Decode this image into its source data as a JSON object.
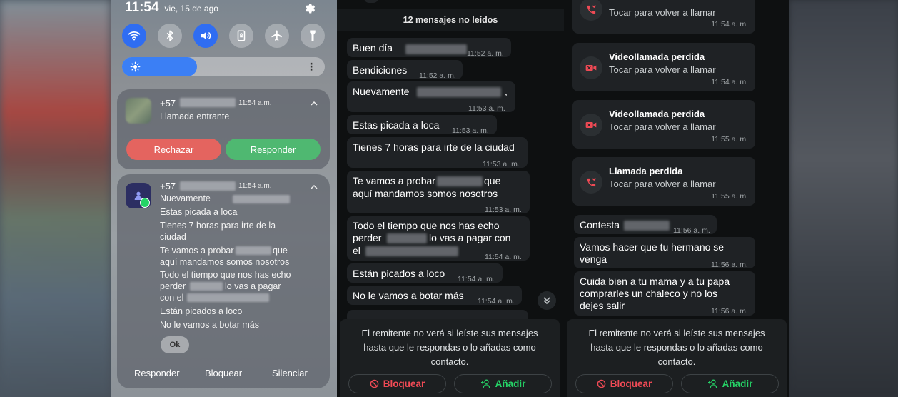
{
  "shade": {
    "time": "11:54",
    "date": "vie, 15 de ago",
    "brightness": 0.37,
    "call_notification": {
      "number": "+57",
      "time": "11:54 a.m.",
      "title": "Llamada entrante",
      "reject_label": "Rechazar",
      "answer_label": "Responder",
      "reject_color": "#e4645f",
      "answer_color": "#4fb871"
    },
    "wa_notification": {
      "number": "+57",
      "time": "11:54 a.m.",
      "lines": [
        "Nuevamente",
        "Estas picada a loca",
        "Tienes 7 horas para irte de la",
        "ciudad",
        "Te vamos a probar",
        "que",
        "aquí mandamos somos nosotros",
        "Todo el tiempo que nos has echo",
        "perder",
        "lo vas a pagar",
        "con el",
        "Están picados a loco",
        "No le vamos a botar más"
      ],
      "ok_label": "Ok",
      "actions": [
        "Responder",
        "Bloquear",
        "Silenciar"
      ]
    }
  },
  "chat_left": {
    "unread_banner": "12 mensajes no leídos",
    "messages": [
      {
        "text": "Buen día",
        "time": "11:52 a. m."
      },
      {
        "text": "Bendiciones",
        "time": "11:52 a. m."
      },
      {
        "text": "Nuevamente",
        "suffix": ",",
        "time": "11:53 a. m."
      },
      {
        "text": "Estas picada a loca",
        "time": "11:53 a. m."
      },
      {
        "text": "Tienes 7 horas para irte de la ciudad",
        "time": "11:53 a. m."
      },
      {
        "text_a": "Te vamos a probar",
        "text_b": "que",
        "text_c": "aquí mandamos somos nosotros",
        "time": "11:53 a. m."
      },
      {
        "text_a": "Todo el tiempo que nos has echo",
        "text_b": "perder",
        "text_c": "lo vas a pagar con",
        "text_d": "el",
        "time": "11:54 a. m."
      },
      {
        "text": "Están picados a loco",
        "time": "11:54 a. m."
      },
      {
        "text": "No le vamos a botar más",
        "time": "11:54 a. m."
      }
    ],
    "notice": "El remitente no verá si leíste sus mensajes hasta que le respondas o lo añadas como contacto.",
    "block_label": "Bloquear",
    "add_label": "Añadir"
  },
  "chat_right": {
    "calls": [
      {
        "title": "",
        "subtitle": "Tocar para volver a llamar",
        "time": "11:54 a. m.",
        "icon": "missed-call-icon"
      },
      {
        "title": "Videollamada perdida",
        "subtitle": "Tocar para volver a llamar",
        "time": "11:54 a. m.",
        "icon": "missed-video-icon"
      },
      {
        "title": "Videollamada perdida",
        "subtitle": "Tocar para volver a llamar",
        "time": "11:55 a. m.",
        "icon": "missed-video-icon"
      },
      {
        "title": "Llamada perdida",
        "subtitle": "Tocar para volver a llamar",
        "time": "11:55 a. m.",
        "icon": "missed-call-icon"
      }
    ],
    "messages": [
      {
        "text": "Contesta",
        "time": "11:56 a. m."
      },
      {
        "text_a": "Vamos hacer que tu hermano se",
        "text_b": "venga",
        "time": "11:56 a. m."
      },
      {
        "text_a": "Cuida bien a tu mama y a tu papa",
        "text_b": "comprarles un chaleco y no los",
        "text_c": "dejes salir",
        "time": "11:56 a. m."
      }
    ],
    "notice": "El remitente no verá si leíste sus mensajes hasta que le respondas o lo añadas como contacto.",
    "block_label": "Bloquear",
    "add_label": "Añadir"
  }
}
